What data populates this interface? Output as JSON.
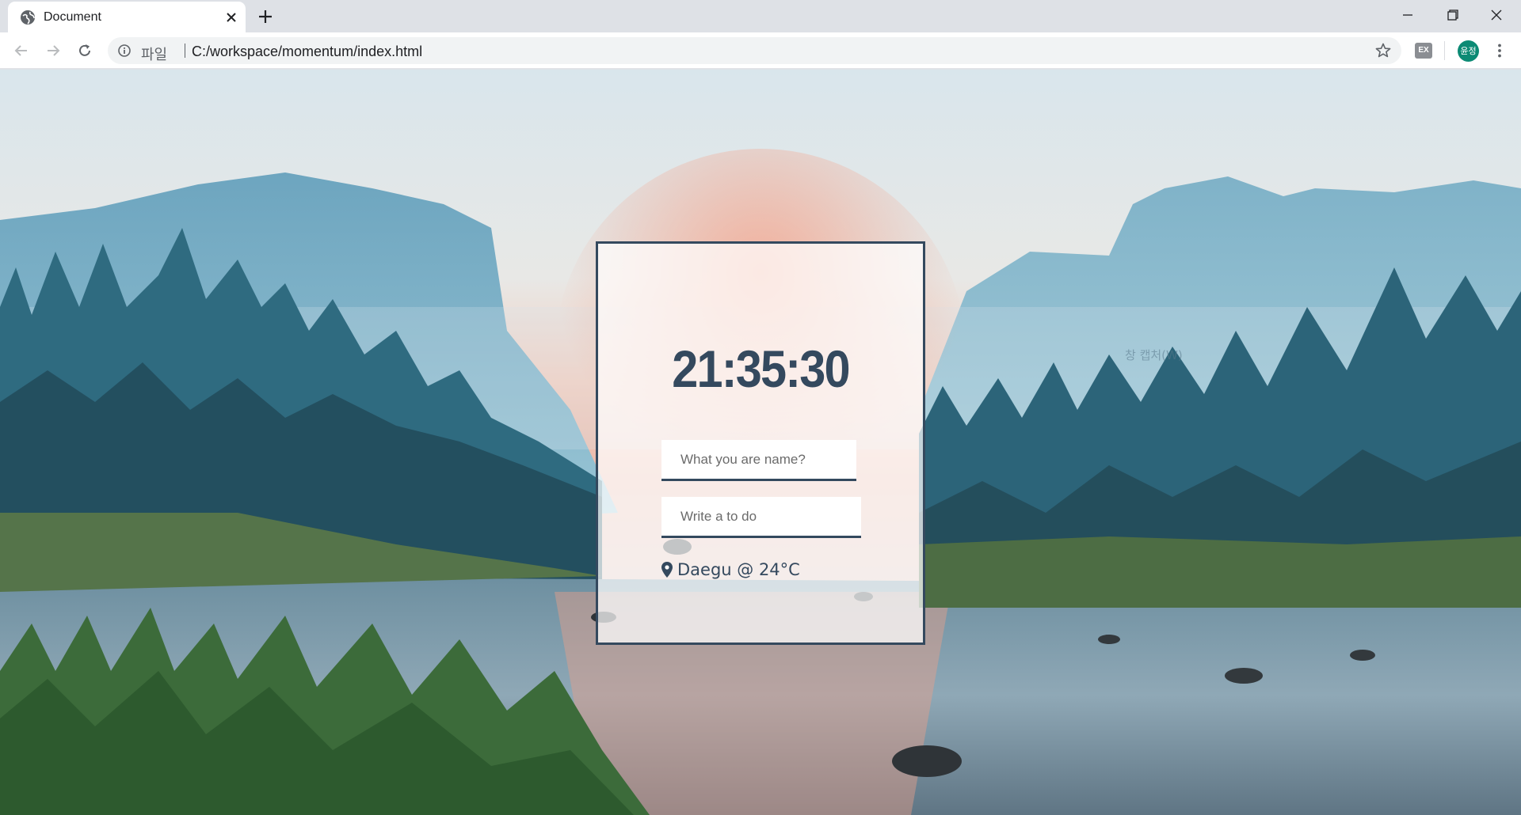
{
  "browser": {
    "tab_title": "Document",
    "address_scheme": "파일",
    "address_url": "C:/workspace/momentum/index.html",
    "extension_label": "EX",
    "profile_initials": "윤정"
  },
  "page": {
    "clock_time": "21:35:30",
    "name_placeholder": "What you are name?",
    "todo_placeholder": "Write a to do",
    "weather_text": "Daegu @ 24°C",
    "watermark_text": "창 캡처(W)"
  },
  "colors": {
    "accent": "#34495e",
    "profile": "#0c8a74"
  }
}
